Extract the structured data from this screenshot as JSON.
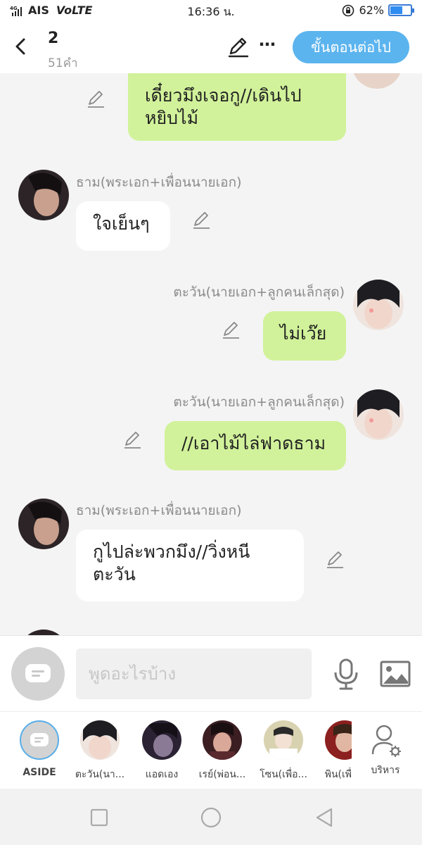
{
  "status": {
    "carrier": "AIS",
    "network": "VoLTE",
    "signal": "4G",
    "time": "16:36 น.",
    "battery": "62%",
    "battery_level": 0.62
  },
  "header": {
    "title": "2",
    "subtitle": "51คำ",
    "next_label": "ขั้นตอนต่อไป"
  },
  "messages": [
    {
      "text": "เดี๋ยวมึงเจอกู//เดินไปหยิบไม้",
      "line1": "เดี๋ยวมึงเจอกู//เดินไป",
      "line2": "หยิบไม้"
    },
    {
      "sender": "ธาม(พระเอก+เพื่อนนายเอก)",
      "text": "ใจเย็นๆ"
    },
    {
      "sender": "ตะวัน(นายเอก+ลูกคนเล็กสุด)",
      "text": "ไม่เว๊ย"
    },
    {
      "sender": "ตะวัน(นายเอก+ลูกคนเล็กสุด)",
      "text": "//เอาไม้ไล่ฟาดธาม"
    },
    {
      "sender": "ธาม(พระเอก+เพื่อนนายเอก)",
      "text": "กูไปล่ะพวกมึง//วิ่งหนีตะวัน",
      "line1": "กูไปล่ะพวกมึง//วิ่งหนี",
      "line2": "ตะวัน"
    }
  ],
  "input": {
    "placeholder": "พูดอะไรบ้าง"
  },
  "characters": [
    {
      "label": "ASIDE"
    },
    {
      "label": "ตะวัน(นา..."
    },
    {
      "label": "แอดเอง"
    },
    {
      "label": "เรย์(พ่อน..."
    },
    {
      "label": "โซน(เพื่อ..."
    },
    {
      "label": "พิน(เพื่"
    },
    {
      "label": "บริหาร"
    }
  ],
  "colors": {
    "accent": "#5bb4ee",
    "bubble_right": "#d1f29a",
    "bubble_left": "#ffffff"
  }
}
